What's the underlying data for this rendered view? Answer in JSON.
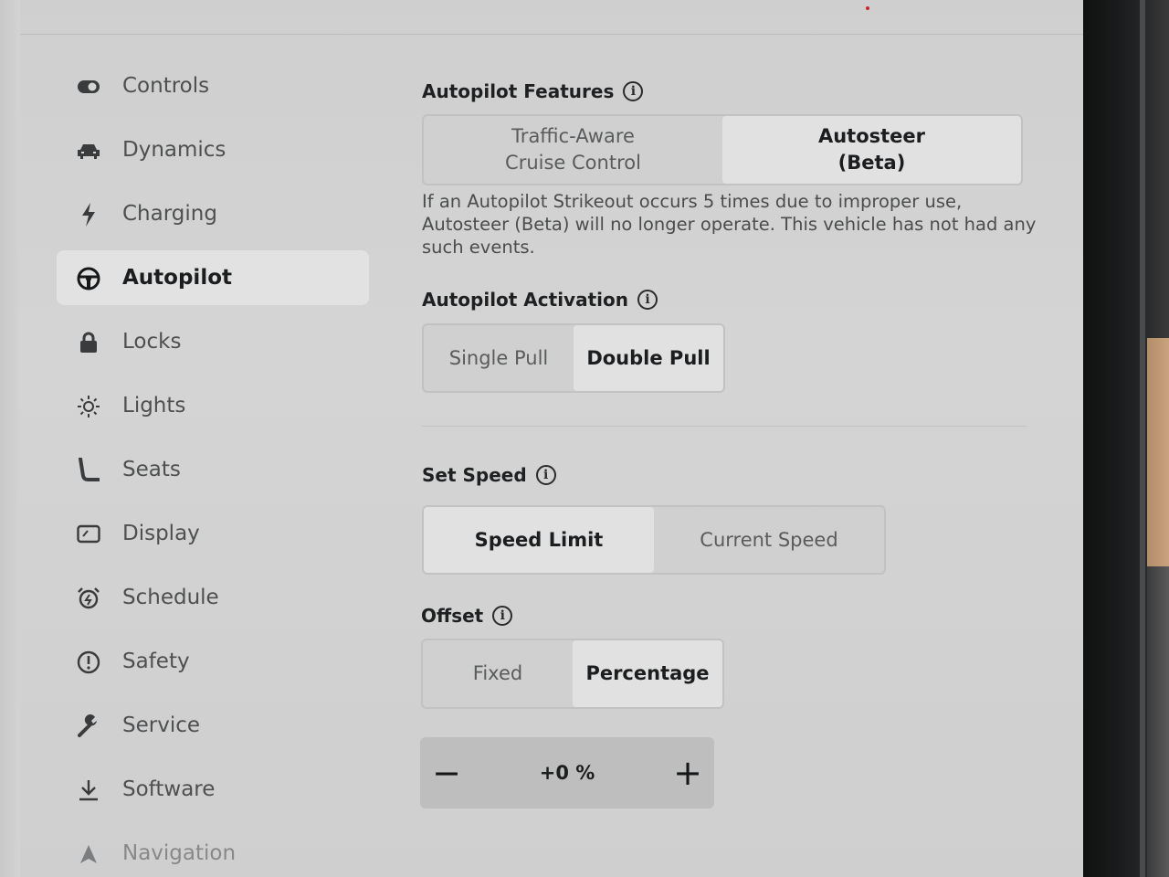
{
  "sidebar": {
    "items": [
      {
        "label": "Controls",
        "icon": "toggle-icon",
        "active": false
      },
      {
        "label": "Dynamics",
        "icon": "car-icon",
        "active": false
      },
      {
        "label": "Charging",
        "icon": "lightning-icon",
        "active": false
      },
      {
        "label": "Autopilot",
        "icon": "steering-wheel-icon",
        "active": true
      },
      {
        "label": "Locks",
        "icon": "lock-icon",
        "active": false
      },
      {
        "label": "Lights",
        "icon": "sun-icon",
        "active": false
      },
      {
        "label": "Seats",
        "icon": "seat-icon",
        "active": false
      },
      {
        "label": "Display",
        "icon": "display-icon",
        "active": false
      },
      {
        "label": "Schedule",
        "icon": "alarm-clock-icon",
        "active": false
      },
      {
        "label": "Safety",
        "icon": "alert-icon",
        "active": false
      },
      {
        "label": "Service",
        "icon": "wrench-icon",
        "active": false
      },
      {
        "label": "Software",
        "icon": "download-icon",
        "active": false
      },
      {
        "label": "Navigation",
        "icon": "navigation-arrow-icon",
        "active": false
      }
    ]
  },
  "autopilot_features": {
    "title": "Autopilot Features",
    "options": [
      "Traffic-Aware\nCruise Control",
      "Autosteer\n(Beta)"
    ],
    "selected": "Autosteer (Beta)",
    "note": "If an Autopilot Strikeout occurs 5 times due to improper use, Autosteer (Beta) will no longer operate. This vehicle has not had any such events."
  },
  "autopilot_activation": {
    "title": "Autopilot Activation",
    "options": [
      "Single Pull",
      "Double Pull"
    ],
    "selected": "Double Pull"
  },
  "set_speed": {
    "title": "Set Speed",
    "options": [
      "Speed Limit",
      "Current Speed"
    ],
    "selected": "Speed Limit"
  },
  "offset": {
    "title": "Offset",
    "options": [
      "Fixed",
      "Percentage"
    ],
    "selected": "Percentage",
    "value": "+0 %",
    "minus": "−",
    "plus": "+"
  },
  "colors": {
    "screen_bg": "#d0d0d0",
    "selected_bg": "#e1e1e1",
    "text_dark": "#1c1d1e",
    "text_muted": "#5a5b5c"
  }
}
